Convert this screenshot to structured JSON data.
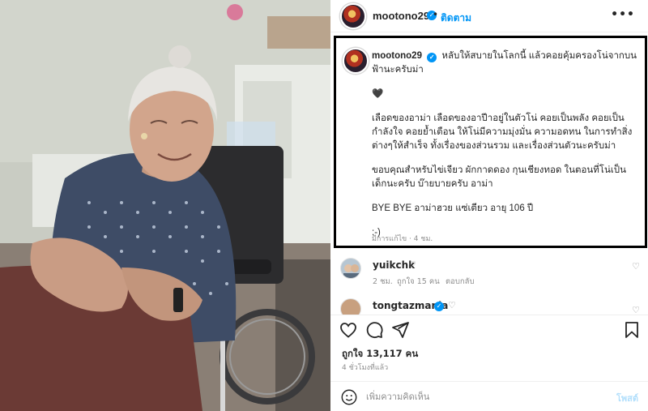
{
  "post": {
    "username": "mootono29",
    "follow_label": "ติดตาม",
    "more_label": "•••"
  },
  "caption": {
    "username": "mootono29",
    "lines": [
      "หลับให้สบายในโลกนี้ แล้วคอยคุ้มครองโน่จากบนฟ้านะครับม่า",
      "🖤",
      "เลือดของอาม่า เลือดของอาปีาอยู่ในตัวโน่ คอยเป็นพลัง คอยเป็นกำลังใจ คอยย้ำเตือน ให้โน่มีความมุ่งมั่น ความอดทน ในการทำสิ่งต่างๆให้สำเร็จ ทั้งเรื่องของส่วนรวม และเรื่องส่วนตัวนะครับม่า",
      "ขอบคุณสำหรับไข่เจียว ผักกาดดอง กุนเชียงทอด ในตอนที่โน่เป็นเด็กนะครับ บ๊ายบายครับ อาม่า",
      "BYE BYE อาม่าฮวย แซ่เตียว อายุ 106 ปี",
      ":-)"
    ],
    "meta": "มีการแก้ไข · 4 ชม."
  },
  "comments": [
    {
      "username": "yuikchk",
      "time": "2 ชม.",
      "likes": "ถูกใจ 15 คน",
      "reply": "ตอบกลับ"
    },
    {
      "username": "tongtazmania"
    }
  ],
  "stats": {
    "likes": "ถูกใจ 13,117 คน",
    "time_ago": "4 ชั่วโมงที่แล้ว"
  },
  "add_comment": {
    "placeholder": "เพิ่มความคิดเห็น",
    "post_label": "โพสต์"
  },
  "icons": {
    "heart": "heart-icon",
    "comment": "comment-icon",
    "share": "share-icon",
    "save": "bookmark-icon",
    "emoji": "emoji-icon",
    "verified": "verified-badge-icon"
  },
  "colors": {
    "accent": "#0095f6",
    "muted": "#8e8e8e",
    "text": "#262626",
    "highlight_border": "#000000"
  }
}
